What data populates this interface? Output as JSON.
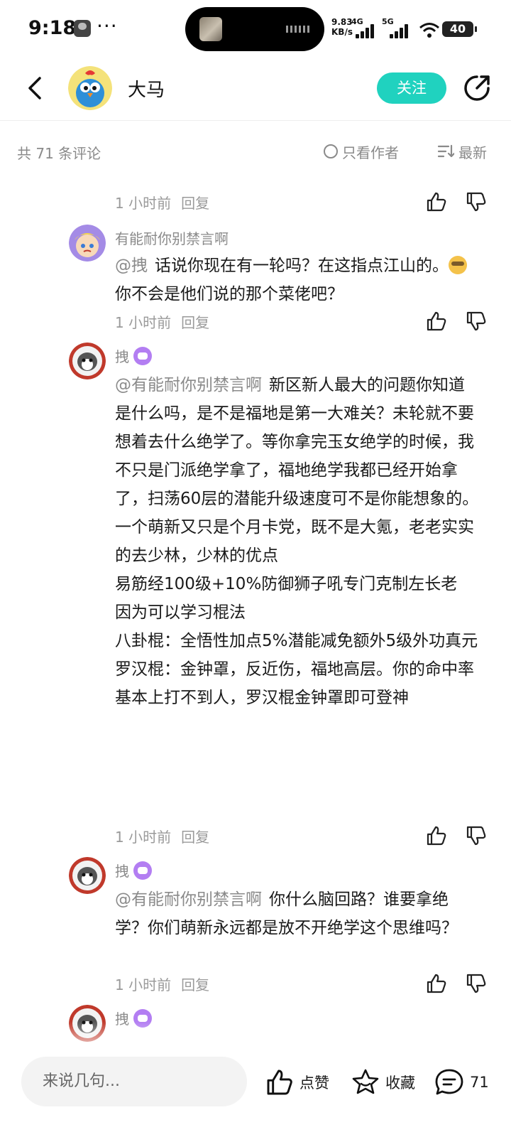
{
  "status_bar": {
    "time": "9:18",
    "dots": "···",
    "net_speed_value": "9.83",
    "net_speed_unit": "KB/s",
    "net1": "4G",
    "net2": "5G",
    "battery": "40"
  },
  "header": {
    "title": "大马",
    "follow_label": "关注"
  },
  "filter": {
    "count_label": "共 71 条评论",
    "author_only_label": "只看作者",
    "sort_label": "最新"
  },
  "comments": [
    {
      "time": "1 小时前",
      "reply": "回复"
    },
    {
      "user": "有能耐你别禁言啊",
      "mention": "@拽",
      "text_part1": "话说你现在有一轮吗？在这指点江山的。",
      "text_part2": "你不会是他们说的那个菜佬吧？",
      "time": "1 小时前",
      "reply": "回复"
    },
    {
      "user": "拽",
      "mention": "@有能耐你别禁言啊",
      "paragraphs": [
        "新区新人最大的问题你知道是什么吗，是不是福地是第一大难关？未轮就不要想着去什么绝学了。等你拿完玉女绝学的时候，我不只是门派绝学拿了，福地绝学我都已经开始拿了，扫荡60层的潜能升级速度可不是你能想象的。一个萌新又只是个月卡党，既不是大氪，老老实实的去少林，少林的优点",
        "易筋经100级+10%防御狮子吼专门克制左长老",
        "因为可以学习棍法",
        "八卦棍：全悟性加点5%潜能减免额外5级外功真元",
        "罗汉棍：金钟罩，反近伤，福地高层。你的命中率基本上打不到人，罗汉棍金钟罩即可登神"
      ],
      "time": "1 小时前",
      "reply": "回复"
    },
    {
      "user": "拽",
      "mention": "@有能耐你别禁言啊",
      "text": "你什么脑回路？谁要拿绝学？你们萌新永远都是放不开绝学这个思维吗？",
      "time": "1 小时前",
      "reply": "回复"
    },
    {
      "user": "拽"
    }
  ],
  "bottom_bar": {
    "input_placeholder": "来说几句...",
    "like_label": "点赞",
    "favorite_label": "收藏",
    "comment_count": "71"
  }
}
